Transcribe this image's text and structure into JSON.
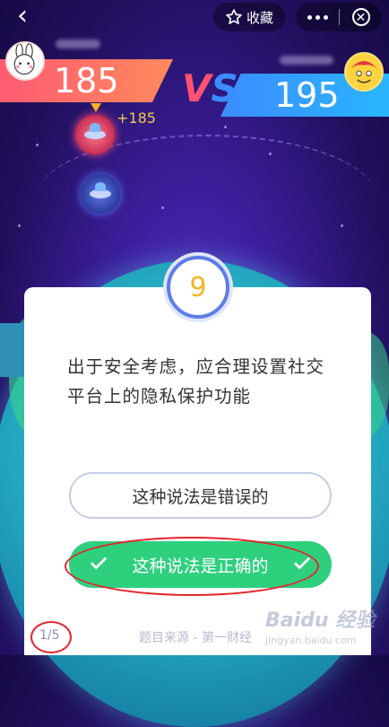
{
  "header": {
    "back_icon": "chevron-left-icon",
    "favorite_label": "收藏",
    "favorite_icon": "star-outline-icon",
    "more_icon": "more-dots-icon",
    "close_icon": "close-circle-icon"
  },
  "players": {
    "left": {
      "score": "185",
      "avatar": "rabbit-avatar",
      "color": "#ff6a66"
    },
    "right": {
      "score": "195",
      "avatar": "cartoon-avatar",
      "color": "#2f9bff"
    }
  },
  "vs": {
    "v": "V",
    "s": "S"
  },
  "gain": "+185",
  "question": {
    "number": "9",
    "text": "出于安全考虑，应合理设置社交平台上的隐私保护功能",
    "options": [
      {
        "label": "这种说法是错误的",
        "state": "default"
      },
      {
        "label": "这种说法是正确的",
        "state": "correct"
      }
    ],
    "progress": "1/5",
    "source": "题目来源 - 第一财经"
  },
  "watermark": {
    "logo": "Baidu 经验",
    "url": "jingyan.baidu.com"
  }
}
